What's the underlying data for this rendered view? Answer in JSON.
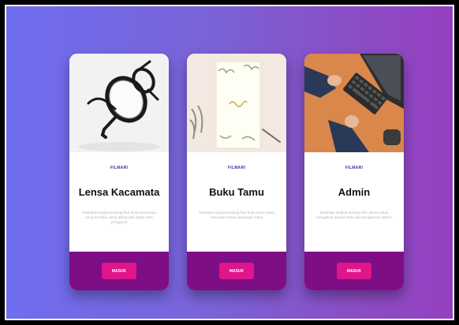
{
  "cards": [
    {
      "tag": "FILMARI",
      "title": "Lensa Kacamata",
      "description": "Deskripsi singkat tentang fitur lensa kacamata yang tersedia untuk dilihat dan dipilih oleh pengguna",
      "button_label": "MASUK",
      "image_icon": "eyeglasses-icon"
    },
    {
      "tag": "FILMARI",
      "title": "Buku Tamu",
      "description": "Deskripsi singkat tentang fitur buku tamu untuk mencatat setiap kunjungan tamu",
      "button_label": "MASUK",
      "image_icon": "guestbook-icon"
    },
    {
      "tag": "FILMARI",
      "title": "Admin",
      "description": "Deskripsi singkat tentang fitur admin untuk mengelola seluruh data dan pengaturan sistem",
      "button_label": "MASUK",
      "image_icon": "keyboard-icon"
    }
  ],
  "colors": {
    "gradient_start": "#6f6ef0",
    "gradient_end": "#9540c0",
    "card_footer": "#7e0e86",
    "button": "#e0148b",
    "tag": "#3a2fa8"
  }
}
